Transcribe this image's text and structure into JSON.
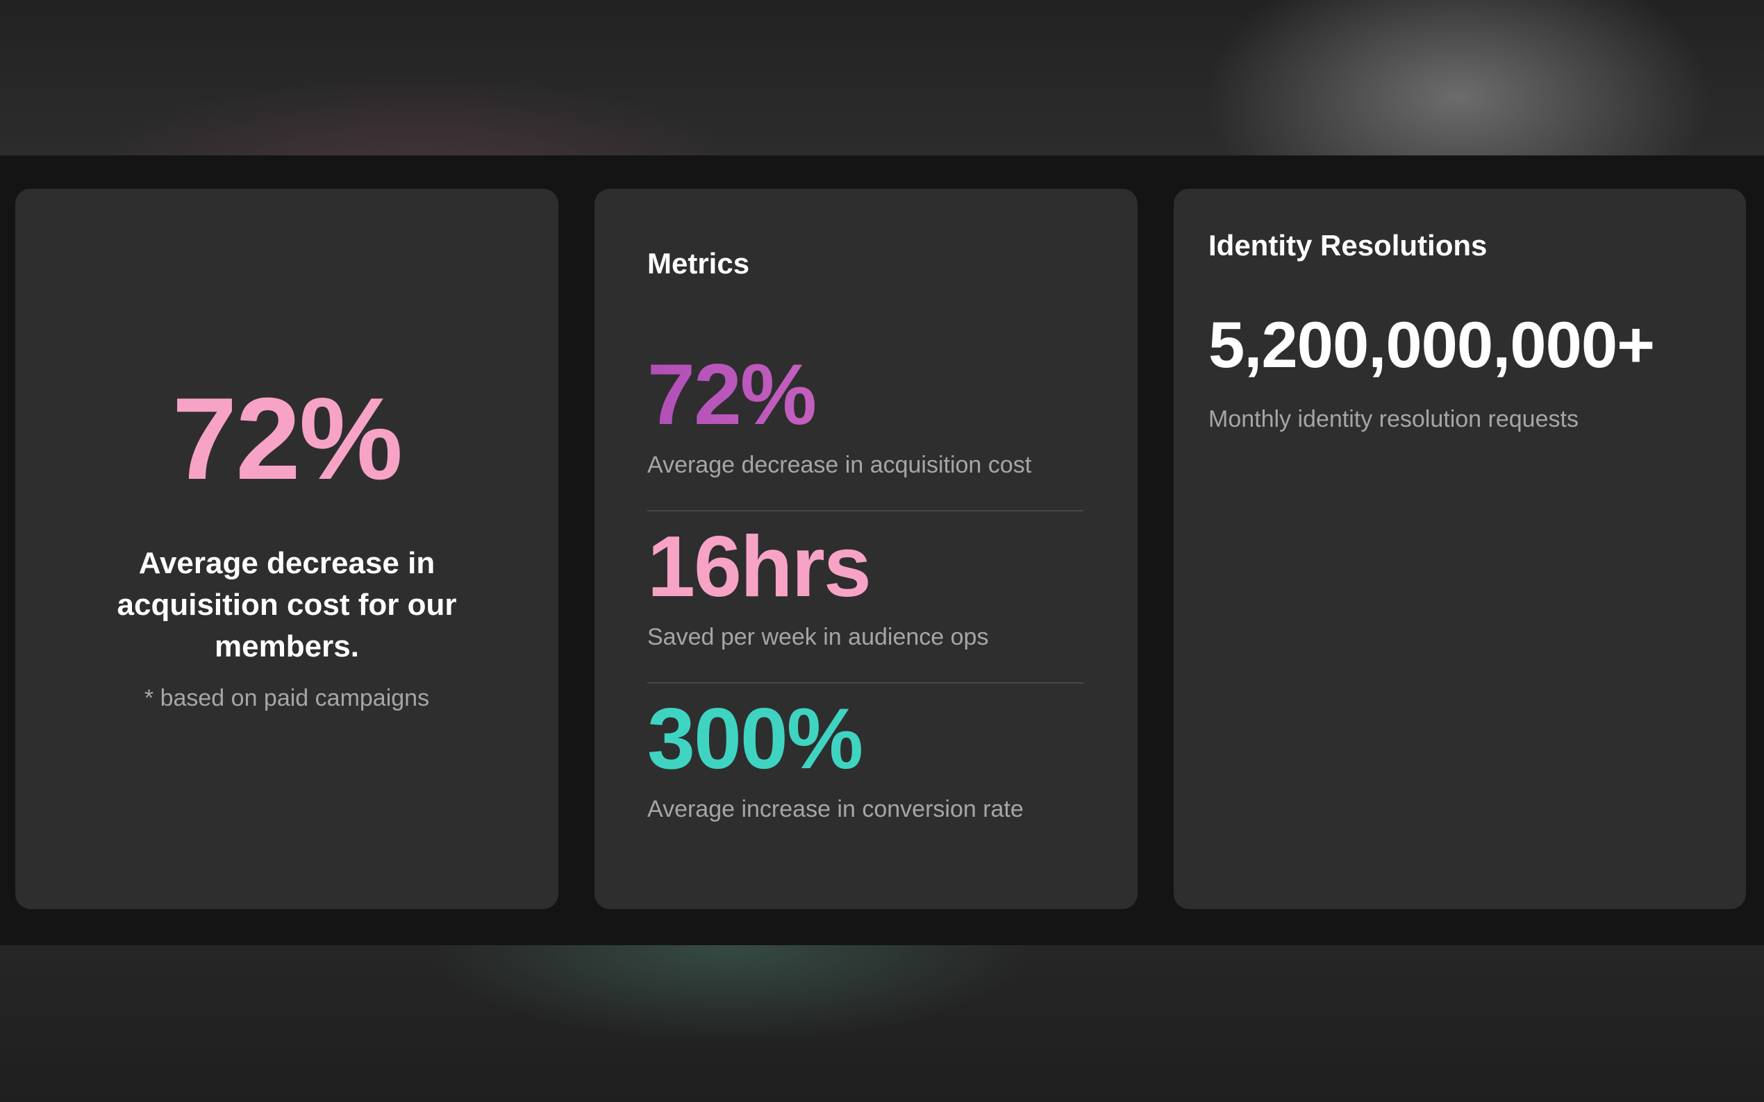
{
  "card_highlight": {
    "value": "72%",
    "description": "Average decrease in acquisition cost for our members.",
    "footnote": "* based on paid campaigns"
  },
  "card_metrics": {
    "title": "Metrics",
    "items": [
      {
        "value": "72%",
        "label": "Average decrease in acquisition cost"
      },
      {
        "value": "16hrs",
        "label": "Saved per week in audience ops"
      },
      {
        "value": "300%",
        "label": "Average increase in conversion rate"
      }
    ]
  },
  "card_identity": {
    "title": "Identity Resolutions",
    "value": "5,200,000,000+",
    "label": "Monthly identity resolution requests"
  },
  "colors": {
    "accent_pink": "#f7a3c6",
    "accent_purple": "#c65fc0",
    "accent_teal": "#3fd4c2",
    "card_bg": "#2e2e2e",
    "page_bg": "#141414"
  }
}
